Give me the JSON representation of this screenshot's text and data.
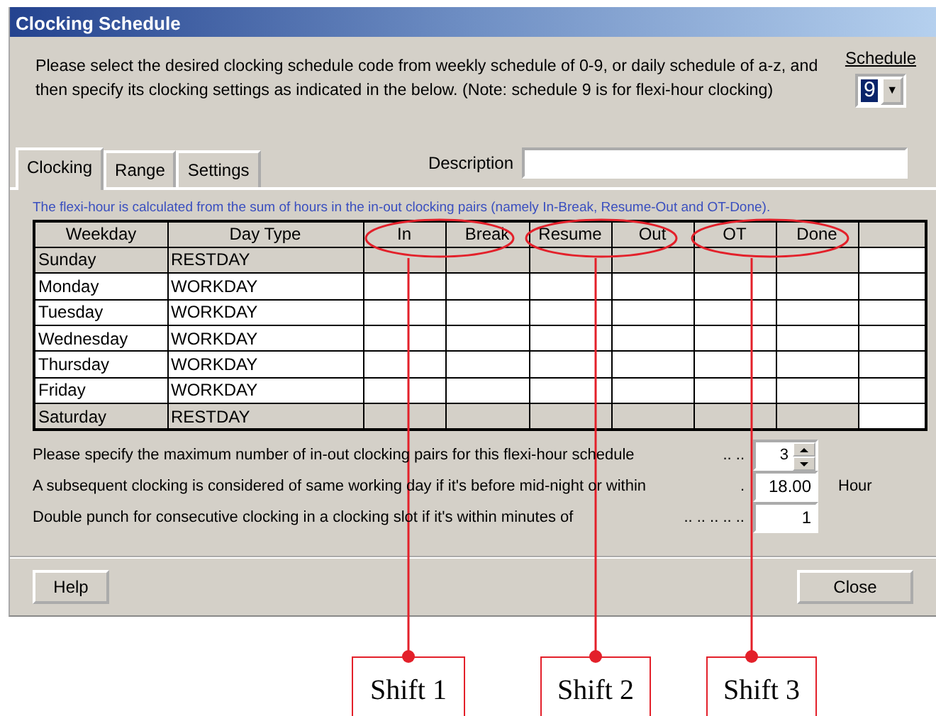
{
  "window": {
    "title": "Clocking Schedule"
  },
  "intro": "Please select the desired clocking schedule code from weekly schedule of 0-9, or daily schedule of a-z, and then specify its clocking settings as indicated in the below. (Note: schedule 9 is for flexi-hour clocking)",
  "schedule": {
    "label": "Schedule",
    "value": "9",
    "arrow": "▼"
  },
  "tabs": [
    {
      "label": "Clocking",
      "selected": true
    },
    {
      "label": "Range",
      "selected": false
    },
    {
      "label": "Settings",
      "selected": false
    }
  ],
  "description": {
    "label": "Description"
  },
  "note": "The flexi-hour is calculated from the sum of hours in the in-out clocking pairs (namely In-Break, Resume-Out and OT-Done).",
  "table": {
    "columns": [
      "Weekday",
      "Day Type",
      "In",
      "Break",
      "Resume",
      "Out",
      "OT",
      "Done"
    ],
    "rows": [
      {
        "weekday": "Sunday",
        "day_type": "RESTDAY",
        "shaded": true
      },
      {
        "weekday": "Monday",
        "day_type": "WORKDAY",
        "shaded": false
      },
      {
        "weekday": "Tuesday",
        "day_type": "WORKDAY",
        "shaded": false
      },
      {
        "weekday": "Wednesday",
        "day_type": "WORKDAY",
        "shaded": false
      },
      {
        "weekday": "Thursday",
        "day_type": "WORKDAY",
        "shaded": false
      },
      {
        "weekday": "Friday",
        "day_type": "WORKDAY",
        "shaded": false
      },
      {
        "weekday": "Saturday",
        "day_type": "RESTDAY",
        "shaded": true
      }
    ]
  },
  "settings": [
    {
      "kind": "spinner",
      "label": "Please specify the maximum number of in-out clocking pairs for this flexi-hour schedule",
      "leader": ".. ..",
      "value": "3"
    },
    {
      "kind": "field",
      "label": "A subsequent clocking is considered of same working day if it's before mid-night or within",
      "leader": ".",
      "value": "18.00",
      "unit": "Hour"
    },
    {
      "kind": "field",
      "label": "Double punch for consecutive clocking in a clocking slot if it's within minutes of",
      "leader": ".. .. .. .. ..",
      "value": "1"
    }
  ],
  "buttons": [
    "Help",
    "Close"
  ],
  "callouts": [
    {
      "label": "Shift 1"
    },
    {
      "label": "Shift 2"
    },
    {
      "label": "Shift 3"
    }
  ]
}
